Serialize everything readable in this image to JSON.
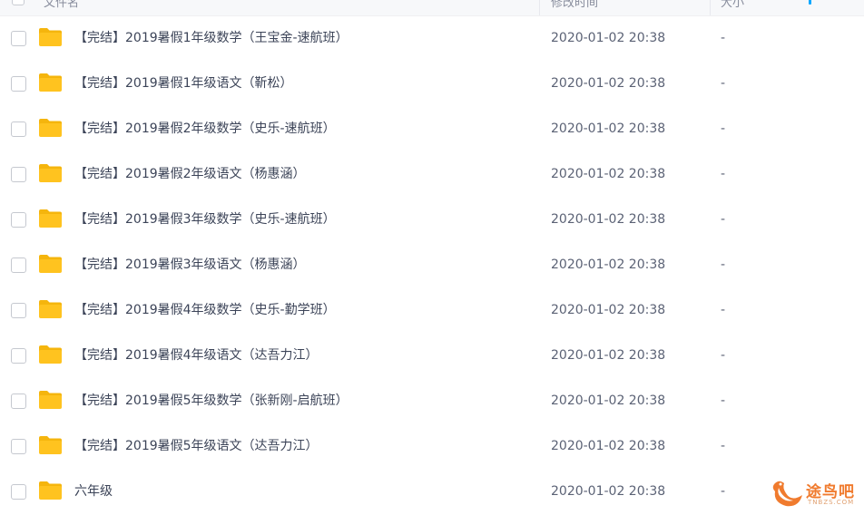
{
  "header": {
    "col_name": "文件名",
    "col_modified": "修改时间",
    "col_size": "大小"
  },
  "files": [
    {
      "name": "【完结】2019暑假1年级数学（王宝金-速航班）",
      "modified": "2020-01-02 20:38",
      "size": "-"
    },
    {
      "name": "【完结】2019暑假1年级语文（靳松）",
      "modified": "2020-01-02 20:38",
      "size": "-"
    },
    {
      "name": "【完结】2019暑假2年级数学（史乐-速航班）",
      "modified": "2020-01-02 20:38",
      "size": "-"
    },
    {
      "name": "【完结】2019暑假2年级语文（杨惠涵）",
      "modified": "2020-01-02 20:38",
      "size": "-"
    },
    {
      "name": "【完结】2019暑假3年级数学（史乐-速航班）",
      "modified": "2020-01-02 20:38",
      "size": "-"
    },
    {
      "name": "【完结】2019暑假3年级语文（杨惠涵）",
      "modified": "2020-01-02 20:38",
      "size": "-"
    },
    {
      "name": "【完结】2019暑假4年级数学（史乐-勤学班）",
      "modified": "2020-01-02 20:38",
      "size": "-"
    },
    {
      "name": "【完结】2019暑假4年级语文（达吾力江）",
      "modified": "2020-01-02 20:38",
      "size": "-"
    },
    {
      "name": "【完结】2019暑假5年级数学（张新刚-启航班）",
      "modified": "2020-01-02 20:38",
      "size": "-"
    },
    {
      "name": "【完结】2019暑假5年级语文（达吾力江）",
      "modified": "2020-01-02 20:38",
      "size": "-"
    },
    {
      "name": "六年级",
      "modified": "2020-01-02 20:38",
      "size": "-"
    }
  ],
  "watermark": {
    "text": "途鸟吧",
    "sub": "TNBZS.COM"
  },
  "colors": {
    "folder": "#ffc31f",
    "folder_dark": "#f5b50d",
    "accent": "#06a7ff",
    "watermark": "#f07b2e"
  },
  "icons": {
    "folder": "folder-icon",
    "watermark_logo": "bird-logo-icon"
  }
}
